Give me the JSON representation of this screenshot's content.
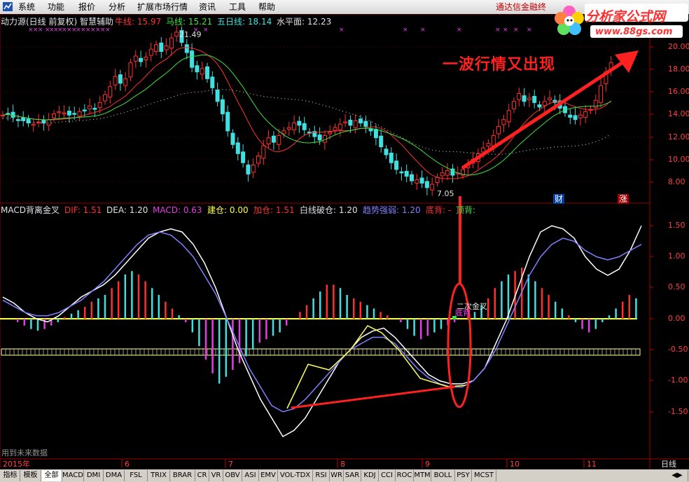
{
  "menubar": {
    "items": [
      "系统",
      "功能",
      "报价",
      "分析",
      "扩展市场行情",
      "资讯",
      "工具",
      "帮助"
    ],
    "tdx_link": "通达信金融终"
  },
  "logo": {
    "text": "分析家公式网",
    "url": "www.88gs.com"
  },
  "price_panel": {
    "title": "动力源(日线 前复权) 智慧辅助",
    "legend": [
      {
        "name": "牛线:",
        "value": "15.97",
        "color": "#ff3030"
      },
      {
        "name": "马线:",
        "value": "15.21",
        "color": "#40e040"
      },
      {
        "name": "五日线:",
        "value": "18.14",
        "color": "#40e0e0"
      },
      {
        "name": "水平面:",
        "value": "12.23",
        "color": "#e0e0e0"
      }
    ],
    "price_labels": [
      "20.00",
      "18.00",
      "16.00",
      "14.00",
      "12.00",
      "10.00",
      "8.00"
    ],
    "high_marker": "21.49",
    "low_marker": "7.05",
    "badges": [
      "财",
      "涨"
    ]
  },
  "macd_panel": {
    "legend": [
      {
        "name": "MACD背离金叉",
        "value": "",
        "color": "#e0e0e0"
      },
      {
        "name": "DIF:",
        "value": "1.51",
        "color": "#ff3030"
      },
      {
        "name": "DEA:",
        "value": "1.20",
        "color": "#e0e0e0"
      },
      {
        "name": "MACD:",
        "value": "0.63",
        "color": "#e040e0"
      },
      {
        "name": "建仓:",
        "value": "0.00",
        "color": "#ffff40"
      },
      {
        "name": "加仓:",
        "value": "1.51",
        "color": "#ff3030"
      },
      {
        "name": "白线破仓:",
        "value": "1.20",
        "color": "#e0e0e0"
      },
      {
        "name": "趋势强弱:",
        "value": "1.20",
        "color": "#8080ff"
      },
      {
        "name": "底背:",
        "value": "-",
        "color": "#ff3030"
      },
      {
        "name": "顶背:",
        "value": "",
        "color": "#40e040"
      }
    ],
    "axis_labels": [
      "1.50",
      "1.00",
      "0.50",
      "0.00",
      "-0.50",
      "-1.00",
      "-1.50"
    ],
    "cross_label": "二次金叉",
    "cross_sub": "底背",
    "footer_note": "用到未来数据"
  },
  "time_axis": {
    "labels": [
      "2015年",
      "6",
      "7",
      "8",
      "9",
      "10",
      "11"
    ],
    "period": "日线"
  },
  "annotation": "一波行情又出现",
  "bottom_tabs": [
    "指标",
    "模板",
    "全部",
    "MACD",
    "DMI",
    "DMA",
    "FSL",
    "TRIX",
    "BRAR",
    "CR",
    "VR",
    "OBV",
    "ASI",
    "EMV",
    "VOL-TDX",
    "RSI",
    "WR",
    "SAR",
    "KDJ",
    "CCI",
    "ROC",
    "MTM",
    "BOLL",
    "PSY",
    "MCST"
  ],
  "colors": {
    "up": "#ff3030",
    "down": "#40e0e0",
    "grid": "#8b0000",
    "bg": "#000000"
  }
}
